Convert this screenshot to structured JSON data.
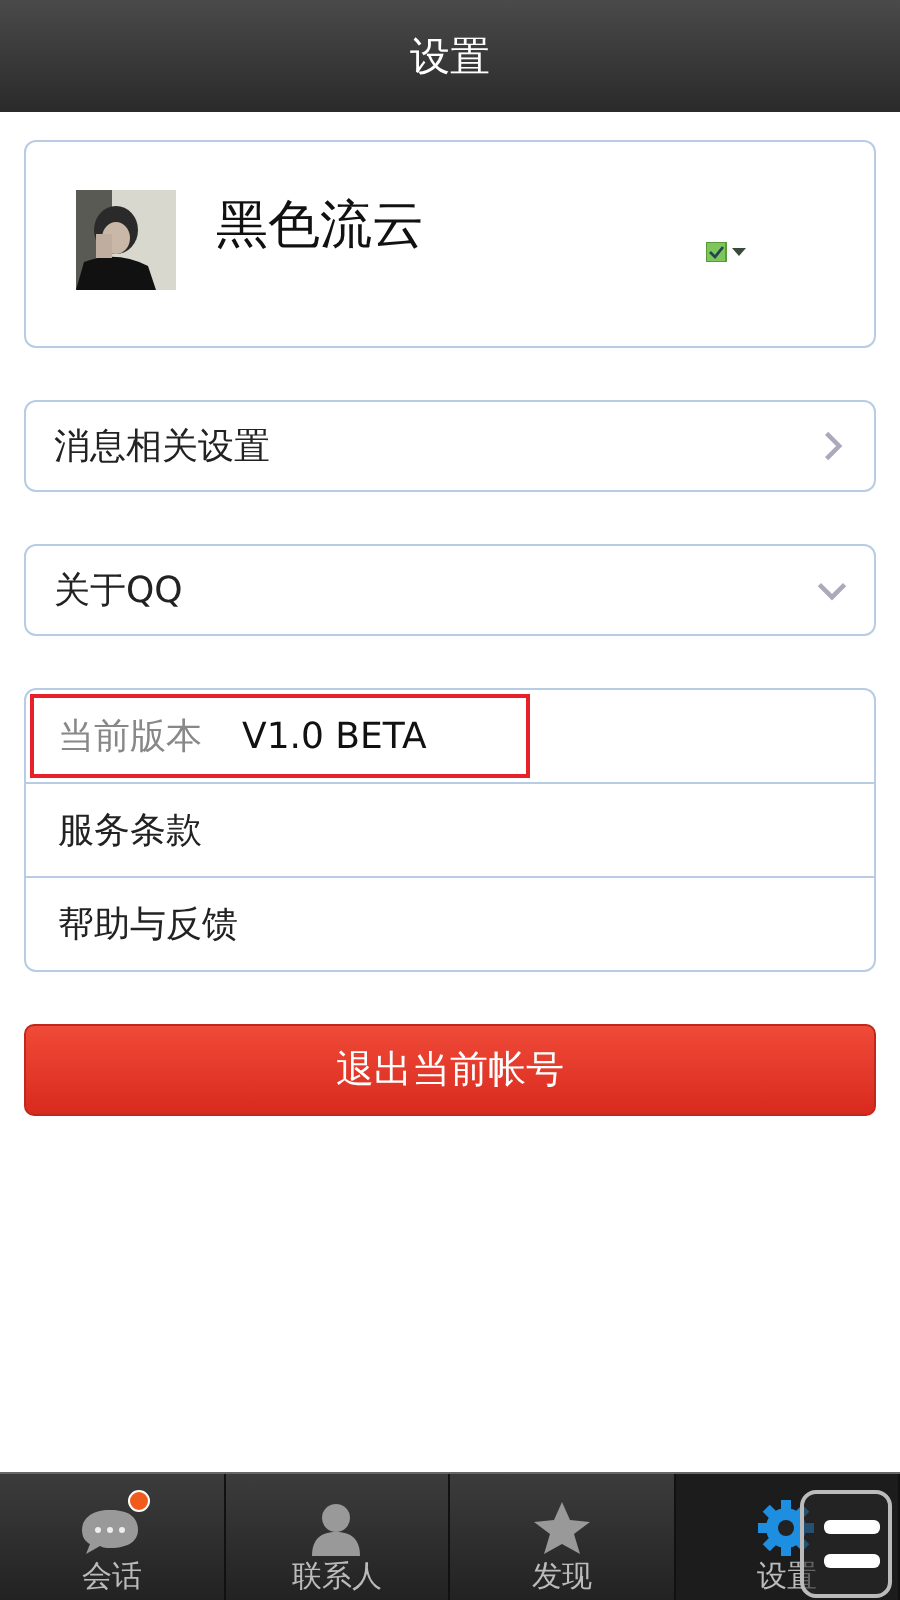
{
  "header": {
    "title": "设置"
  },
  "profile": {
    "name": "黑色流云"
  },
  "menu_rows": [
    {
      "label": "消息相关设置",
      "expanded": false
    },
    {
      "label": "关于QQ",
      "expanded": true
    }
  ],
  "about_items": [
    {
      "label": "当前版本",
      "value": "V1.0 BETA",
      "highlighted": true
    },
    {
      "label": "服务条款",
      "highlighted": false
    },
    {
      "label": "帮助与反馈",
      "highlighted": false
    }
  ],
  "logout_button": "退出当前帐号",
  "tabs": [
    {
      "label": "会话",
      "badge": true,
      "selected": false
    },
    {
      "label": "联系人",
      "badge": false,
      "selected": false
    },
    {
      "label": "发现",
      "badge": false,
      "selected": false
    },
    {
      "label": "设置",
      "badge": false,
      "selected": true
    }
  ]
}
